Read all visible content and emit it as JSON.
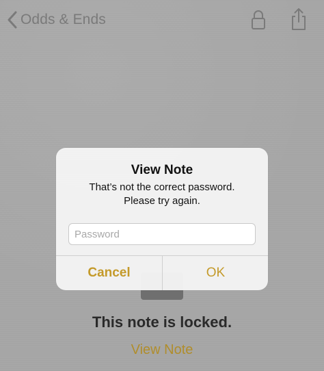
{
  "nav": {
    "back_label": "Odds & Ends"
  },
  "icons": {
    "back": "chevron-left-icon",
    "lock": "lock-icon",
    "share": "share-icon"
  },
  "note": {
    "locked_title": "This note is locked.",
    "view_link": "View Note"
  },
  "alert": {
    "title": "View Note",
    "message_line1": "That’s not the correct password.",
    "message_line2": "Please try again.",
    "password_placeholder": "Password",
    "password_value": "",
    "cancel_label": "Cancel",
    "ok_label": "OK"
  },
  "colors": {
    "accent": "#c49a2a",
    "background": "#a7a7a7"
  }
}
